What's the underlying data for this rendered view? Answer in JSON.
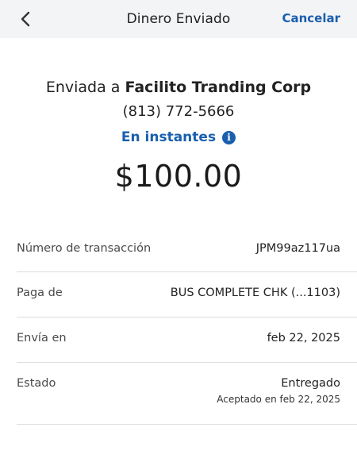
{
  "header": {
    "title": "Dinero Enviado",
    "cancel_label": "Cancelar",
    "back_icon": "chevron-left-icon"
  },
  "summary": {
    "sent_prefix": "Enviada a",
    "recipient": "Facilito Tranding Corp",
    "phone": "(813) 772-5666",
    "speed": "En instantes",
    "info_icon": "info-icon",
    "amount": "$100.00"
  },
  "details": [
    {
      "label": "Número de transacción",
      "value": "JPM99az117ua"
    },
    {
      "label": "Paga de",
      "value": "BUS COMPLETE CHK (...1103)"
    },
    {
      "label": "Envía en",
      "value": "feb 22, 2025"
    },
    {
      "label": "Estado",
      "value": "Entregado",
      "sub": "Aceptado en feb 22, 2025"
    }
  ],
  "colors": {
    "accent": "#1a5fad",
    "header_bg": "#f3f4f6",
    "divider": "#dcdcdc"
  }
}
